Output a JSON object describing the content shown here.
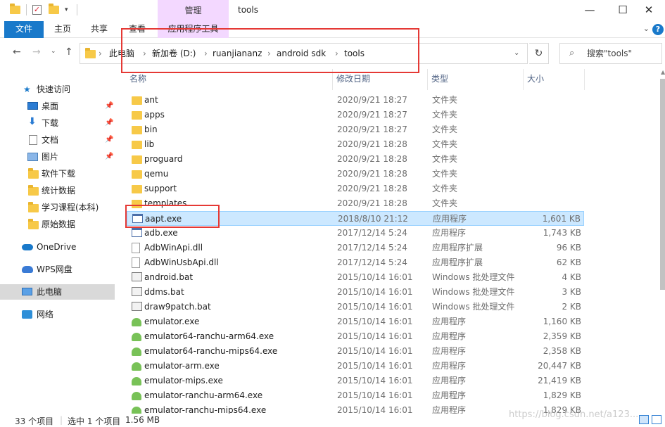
{
  "window": {
    "title": "tools",
    "manage_tab": "管理"
  },
  "ribbon": {
    "tabs": [
      "文件",
      "主页",
      "共享",
      "查看",
      "应用程序工具"
    ]
  },
  "address": {
    "crumbs": [
      "此电脑",
      "新加卷 (D:)",
      "ruanjiananz",
      "android sdk",
      "tools"
    ],
    "separator": "›"
  },
  "search": {
    "placeholder": "搜索\"tools\""
  },
  "nav": {
    "quick_access": "快速访问",
    "items": [
      {
        "label": "桌面",
        "pinned": true
      },
      {
        "label": "下载",
        "pinned": true
      },
      {
        "label": "文档",
        "pinned": true
      },
      {
        "label": "图片",
        "pinned": true
      },
      {
        "label": "软件下载",
        "pinned": false
      },
      {
        "label": "统计数据",
        "pinned": false
      },
      {
        "label": "学习课程(本科)",
        "pinned": false
      },
      {
        "label": "原始数据",
        "pinned": false
      }
    ],
    "onedrive": "OneDrive",
    "wps": "WPS网盘",
    "this_pc": "此电脑",
    "network": "网络"
  },
  "columns": {
    "name": "名称",
    "date": "修改日期",
    "type": "类型",
    "size": "大小"
  },
  "files": [
    {
      "name": "ant",
      "date": "2020/9/21 18:27",
      "type": "文件夹",
      "size": "",
      "icon": "folder"
    },
    {
      "name": "apps",
      "date": "2020/9/21 18:27",
      "type": "文件夹",
      "size": "",
      "icon": "folder"
    },
    {
      "name": "bin",
      "date": "2020/9/21 18:27",
      "type": "文件夹",
      "size": "",
      "icon": "folder"
    },
    {
      "name": "lib",
      "date": "2020/9/21 18:28",
      "type": "文件夹",
      "size": "",
      "icon": "folder"
    },
    {
      "name": "proguard",
      "date": "2020/9/21 18:28",
      "type": "文件夹",
      "size": "",
      "icon": "folder"
    },
    {
      "name": "qemu",
      "date": "2020/9/21 18:28",
      "type": "文件夹",
      "size": "",
      "icon": "folder"
    },
    {
      "name": "support",
      "date": "2020/9/21 18:28",
      "type": "文件夹",
      "size": "",
      "icon": "folder"
    },
    {
      "name": "templates",
      "date": "2020/9/21 18:28",
      "type": "文件夹",
      "size": "",
      "icon": "folder"
    },
    {
      "name": "aapt.exe",
      "date": "2018/8/10 21:12",
      "type": "应用程序",
      "size": "1,601 KB",
      "icon": "exe",
      "selected": true
    },
    {
      "name": "adb.exe",
      "date": "2017/12/14 5:24",
      "type": "应用程序",
      "size": "1,743 KB",
      "icon": "exe"
    },
    {
      "name": "AdbWinApi.dll",
      "date": "2017/12/14 5:24",
      "type": "应用程序扩展",
      "size": "96 KB",
      "icon": "dll"
    },
    {
      "name": "AdbWinUsbApi.dll",
      "date": "2017/12/14 5:24",
      "type": "应用程序扩展",
      "size": "62 KB",
      "icon": "dll"
    },
    {
      "name": "android.bat",
      "date": "2015/10/14 16:01",
      "type": "Windows 批处理文件",
      "size": "4 KB",
      "icon": "bat"
    },
    {
      "name": "ddms.bat",
      "date": "2015/10/14 16:01",
      "type": "Windows 批处理文件",
      "size": "3 KB",
      "icon": "bat"
    },
    {
      "name": "draw9patch.bat",
      "date": "2015/10/14 16:01",
      "type": "Windows 批处理文件",
      "size": "2 KB",
      "icon": "bat"
    },
    {
      "name": "emulator.exe",
      "date": "2015/10/14 16:01",
      "type": "应用程序",
      "size": "1,160 KB",
      "icon": "android"
    },
    {
      "name": "emulator64-ranchu-arm64.exe",
      "date": "2015/10/14 16:01",
      "type": "应用程序",
      "size": "2,359 KB",
      "icon": "android"
    },
    {
      "name": "emulator64-ranchu-mips64.exe",
      "date": "2015/10/14 16:01",
      "type": "应用程序",
      "size": "2,358 KB",
      "icon": "android"
    },
    {
      "name": "emulator-arm.exe",
      "date": "2015/10/14 16:01",
      "type": "应用程序",
      "size": "20,447 KB",
      "icon": "android"
    },
    {
      "name": "emulator-mips.exe",
      "date": "2015/10/14 16:01",
      "type": "应用程序",
      "size": "21,419 KB",
      "icon": "android"
    },
    {
      "name": "emulator-ranchu-arm64.exe",
      "date": "2015/10/14 16:01",
      "type": "应用程序",
      "size": "1,829 KB",
      "icon": "android"
    },
    {
      "name": "emulator-ranchu-mips64.exe",
      "date": "2015/10/14 16:01",
      "type": "应用程序",
      "size": "1,829 KB",
      "icon": "android"
    }
  ],
  "status": {
    "count": "33 个项目",
    "selected": "选中 1 个项目",
    "size": "1.56 MB"
  },
  "watermark": "https://blog.csdn.net/a123...",
  "colors": {
    "accent": "#1979ca",
    "manage_tab": "#f3d8ff",
    "selection": "#cce8ff",
    "annotation": "#e53935"
  }
}
